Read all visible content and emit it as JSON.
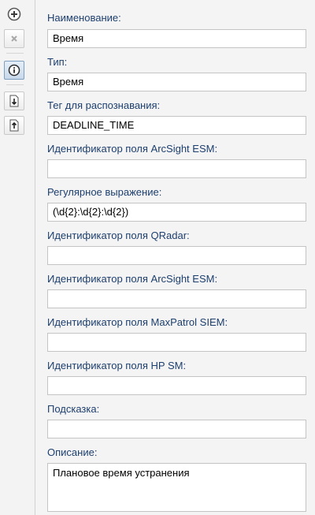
{
  "toolbar": {
    "icons": [
      "add-circle-icon",
      "close-icon",
      "info-icon",
      "import-icon",
      "export-icon"
    ]
  },
  "form": {
    "name": {
      "label": "Наименование:",
      "value": "Время"
    },
    "type": {
      "label": "Тип:",
      "value": "Время"
    },
    "tag": {
      "label": "Тег для распознавания:",
      "value": "DEADLINE_TIME"
    },
    "arcsight1": {
      "label": "Идентификатор поля ArcSight ESM:",
      "value": ""
    },
    "regex": {
      "label": "Регулярное выражение:",
      "value": "(\\d{2}:\\d{2}:\\d{2})"
    },
    "qradar": {
      "label": "Идентификатор поля QRadar:",
      "value": ""
    },
    "arcsight2": {
      "label": "Идентификатор поля ArcSight ESM:",
      "value": ""
    },
    "maxpatrol": {
      "label": "Идентификатор поля MaxPatrol SIEM:",
      "value": ""
    },
    "hpsm": {
      "label": "Идентификатор поля HP SM:",
      "value": ""
    },
    "hint": {
      "label": "Подсказка:",
      "value": ""
    },
    "description": {
      "label": "Описание:",
      "value": "Плановое время устранения"
    }
  }
}
